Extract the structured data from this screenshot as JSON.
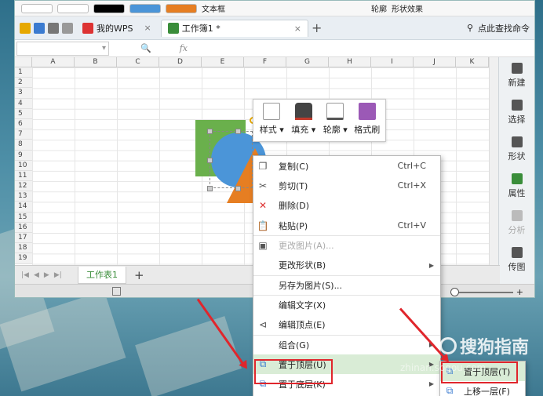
{
  "ribbon": {
    "textbox_label": "文本框",
    "outline_label": "轮廓",
    "effects_label": "形状效果"
  },
  "tabs": [
    {
      "label": "我的WPS"
    },
    {
      "label": "工作簿1 *"
    }
  ],
  "tabbar": {
    "find_label": "点此查找命令"
  },
  "formula": {
    "fx": "fx"
  },
  "columns": [
    "A",
    "B",
    "C",
    "D",
    "E",
    "F",
    "G",
    "H",
    "I",
    "J",
    "K"
  ],
  "rows": [
    "1",
    "2",
    "3",
    "4",
    "5",
    "6",
    "7",
    "8",
    "9",
    "10",
    "11",
    "12",
    "13",
    "14",
    "15",
    "16",
    "17",
    "18",
    "19"
  ],
  "sheet_tab": "工作表1",
  "right_panel": [
    {
      "label": "新建",
      "state": "normal"
    },
    {
      "label": "选择",
      "state": "normal"
    },
    {
      "label": "形状",
      "state": "normal"
    },
    {
      "label": "属性",
      "state": "active"
    },
    {
      "label": "分析",
      "state": "disabled"
    },
    {
      "label": "传图",
      "state": "normal"
    }
  ],
  "float_toolbar": [
    {
      "label": "样式 ▾"
    },
    {
      "label": "填充 ▾"
    },
    {
      "label": "轮廓 ▾"
    },
    {
      "label": "格式刷"
    }
  ],
  "context_menu": [
    {
      "label": "复制(C)",
      "shortcut": "Ctrl+C",
      "icon": "copy-icon"
    },
    {
      "label": "剪切(T)",
      "shortcut": "Ctrl+X",
      "icon": "cut-icon"
    },
    {
      "label": "删除(D)",
      "shortcut": "",
      "icon": "delete-icon"
    },
    {
      "label": "粘贴(P)",
      "shortcut": "Ctrl+V",
      "icon": "paste-icon"
    },
    {
      "label": "更改图片(A)...",
      "shortcut": "",
      "icon": "change-picture-icon",
      "disabled": true
    },
    {
      "label": "更改形状(B)",
      "shortcut": "",
      "submenu": true
    },
    {
      "label": "另存为图片(S)...",
      "shortcut": ""
    },
    {
      "label": "编辑文字(X)",
      "shortcut": ""
    },
    {
      "label": "编辑顶点(E)",
      "shortcut": "",
      "icon": "edit-points-icon"
    },
    {
      "label": "组合(G)",
      "shortcut": "",
      "submenu": true
    },
    {
      "label": "置于顶层(U)",
      "shortcut": "",
      "submenu": true,
      "highlighted": true,
      "icon": "bring-front-icon"
    },
    {
      "label": "置于底层(K)",
      "shortcut": "",
      "submenu": true,
      "icon": "send-back-icon"
    }
  ],
  "submenu": [
    {
      "label": "置于顶层(T)"
    },
    {
      "label": "上移一层(F)"
    }
  ],
  "watermark": {
    "brand": "搜狗指南",
    "url": "zhinan.sogou.com"
  },
  "colors": {
    "accent": "#3a8d3a",
    "highlight": "#d9ecd6",
    "annotation": "#e0262c"
  }
}
